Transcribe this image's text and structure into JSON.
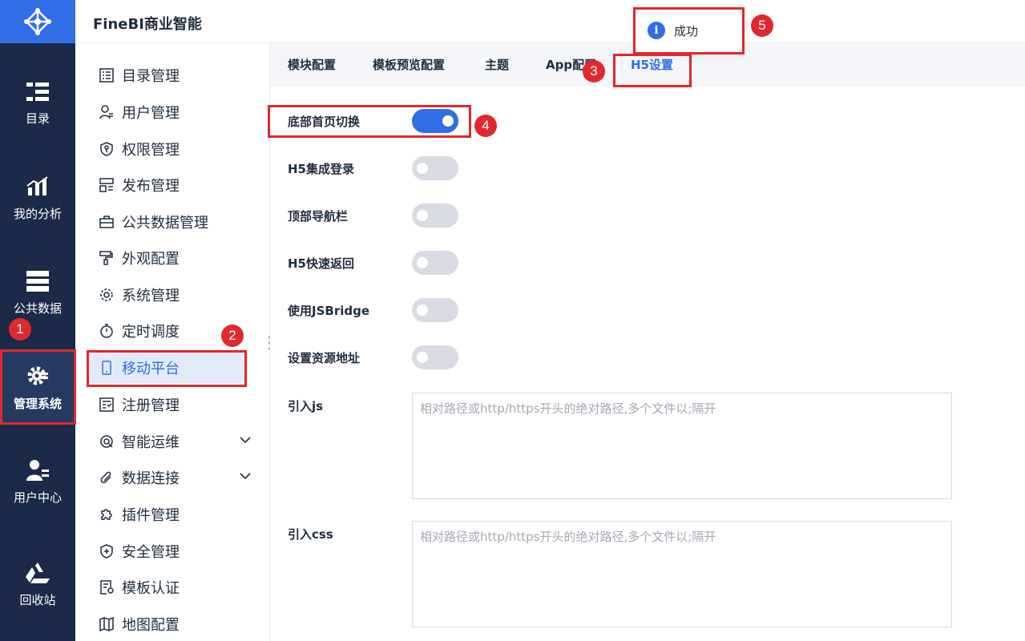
{
  "header": {
    "title": "FineBI商业智能"
  },
  "rail": {
    "items": [
      {
        "label": "目录",
        "icon": "catalog-icon"
      },
      {
        "label": "我的分析",
        "icon": "analysis-icon"
      },
      {
        "label": "公共数据",
        "icon": "public-data-icon"
      },
      {
        "label": "管理系统",
        "icon": "gear-icon"
      },
      {
        "label": "用户中心",
        "icon": "user-center-icon"
      },
      {
        "label": "回收站",
        "icon": "recycle-icon"
      }
    ]
  },
  "subnav": {
    "items": [
      {
        "label": "目录管理",
        "icon": "list-icon"
      },
      {
        "label": "用户管理",
        "icon": "user-icon"
      },
      {
        "label": "权限管理",
        "icon": "shield-key-icon"
      },
      {
        "label": "发布管理",
        "icon": "publish-icon"
      },
      {
        "label": "公共数据管理",
        "icon": "briefcase-icon"
      },
      {
        "label": "外观配置",
        "icon": "paint-roller-icon"
      },
      {
        "label": "系统管理",
        "icon": "gear-icon"
      },
      {
        "label": "定时调度",
        "icon": "stopwatch-icon"
      },
      {
        "label": "移动平台",
        "icon": "mobile-icon"
      },
      {
        "label": "注册管理",
        "icon": "register-icon"
      },
      {
        "label": "智能运维",
        "icon": "ops-icon"
      },
      {
        "label": "数据连接",
        "icon": "paperclip-icon"
      },
      {
        "label": "插件管理",
        "icon": "puzzle-icon"
      },
      {
        "label": "安全管理",
        "icon": "shield-plus-icon"
      },
      {
        "label": "模板认证",
        "icon": "certificate-icon"
      },
      {
        "label": "地图配置",
        "icon": "map-icon"
      }
    ]
  },
  "tabs": [
    {
      "label": "模块配置"
    },
    {
      "label": "模板预览配置"
    },
    {
      "label": "主题"
    },
    {
      "label": "App配置"
    },
    {
      "label": "H5设置"
    }
  ],
  "settings": {
    "bottom_home_switch": {
      "label": "底部首页切换",
      "on": true
    },
    "h5_login": {
      "label": "H5集成登录",
      "on": false
    },
    "top_nav": {
      "label": "顶部导航栏",
      "on": false
    },
    "h5_quick_back": {
      "label": "H5快速返回",
      "on": false
    },
    "jsbridge": {
      "label": "使用JSBridge",
      "on": false
    },
    "resource_addr": {
      "label": "设置资源地址",
      "on": false
    },
    "import_js": {
      "label": "引入js",
      "placeholder": "相对路径或http/https开头的绝对路径,多个文件以;隔开"
    },
    "import_css": {
      "label": "引入css",
      "placeholder": "相对路径或http/https开头的绝对路径,多个文件以;隔开"
    }
  },
  "toast": {
    "message": "成功"
  },
  "annotations": [
    "1",
    "2",
    "3",
    "4",
    "5"
  ],
  "colors": {
    "accent": "#2f6ee6",
    "rail_bg": "#1b2a48",
    "highlight": "#e0282e"
  }
}
